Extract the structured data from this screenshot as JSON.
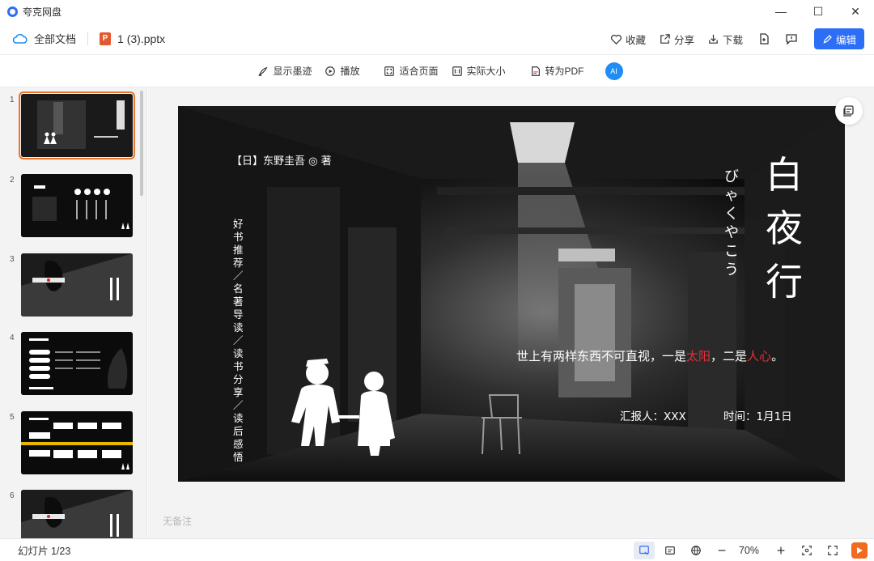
{
  "app": {
    "title": "夸克网盘"
  },
  "window_controls": {
    "minimize": "—",
    "maximize": "☐",
    "close": "✕"
  },
  "docbar": {
    "all_docs": "全部文档",
    "file_name": "1 (3).pptx",
    "ppt_badge": "P",
    "actions": {
      "favorite": "收藏",
      "share": "分享",
      "download": "下载",
      "edit": "编辑"
    }
  },
  "toolbar": {
    "show_ink": "显示墨迹",
    "play": "播放",
    "fit_page": "适合页面",
    "actual_size": "实际大小",
    "to_pdf": "转为PDF",
    "ai": "AI"
  },
  "thumbnails": [
    {
      "num": "1",
      "active": true
    },
    {
      "num": "2",
      "active": false
    },
    {
      "num": "3",
      "active": false
    },
    {
      "num": "4",
      "active": false
    },
    {
      "num": "5",
      "active": false
    },
    {
      "num": "6",
      "active": false
    }
  ],
  "slide": {
    "author": "【日】东野圭吾 ◎ 著",
    "vertical_text": "好书推荐／名著导读／读书分享／读后感悟",
    "title": "白夜行",
    "kana": "びゃくやこう",
    "quote_prefix": "世上有两样东西不可直视，一是",
    "quote_red1": "太阳",
    "quote_mid": "，二是",
    "quote_red2": "人心",
    "quote_suffix": "。",
    "reporter": "汇报人：XXX",
    "date": "时间：1月1日"
  },
  "notes_placeholder": "无备注",
  "status": {
    "slide_count": "幻灯片 1/23",
    "zoom": "70%"
  },
  "colors": {
    "accent": "#2d6ef6",
    "active_thumb": "#e8762c",
    "highlight_red": "#e0303a",
    "play": "#f06a1f"
  }
}
